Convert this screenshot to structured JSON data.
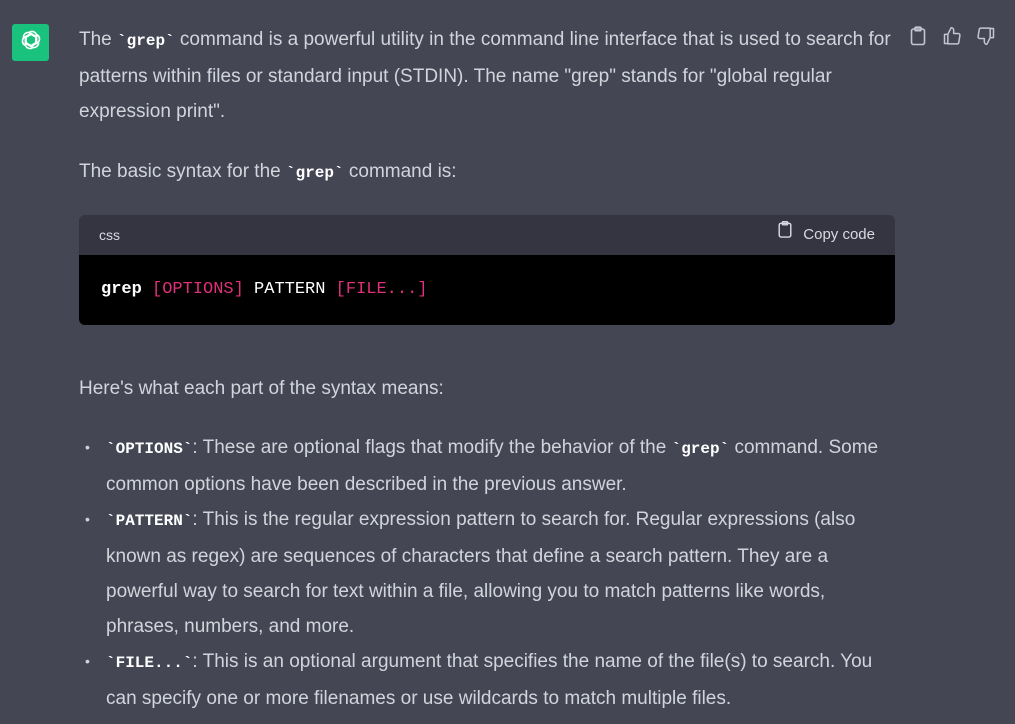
{
  "assistant": {
    "avatar_icon": "openai-logo-icon",
    "avatar_color": "#19c37d"
  },
  "actions": [
    {
      "icon": "clipboard-icon"
    },
    {
      "icon": "thumbs-up-icon"
    },
    {
      "icon": "thumbs-down-icon"
    }
  ],
  "message": {
    "p1": {
      "t1": "The ",
      "code1": "`grep`",
      "t2": " command is a powerful utility in the command line interface that is used to search for patterns within files or standard input (STDIN). The name \"grep\" stands for \"global regular expression print\"."
    },
    "p2": {
      "t1": "The basic syntax for the ",
      "code1": "`grep`",
      "t2": " command is:"
    },
    "codeblock": {
      "language": "css",
      "copy_label": "Copy code",
      "tokens": {
        "cmd": "grep",
        "sp1": " ",
        "options": "[OPTIONS]",
        "sp2": " ",
        "pattern": "PATTERN",
        "sp3": " ",
        "file": "[FILE...]"
      }
    },
    "p3": "Here's what each part of the syntax means:",
    "bullets": [
      {
        "code": "`OPTIONS`",
        "t1": ": These are optional flags that modify the behavior of the ",
        "code2": "`grep`",
        "t2": " command. Some common options have been described in the previous answer."
      },
      {
        "code": "`PATTERN`",
        "t1": ": This is the regular expression pattern to search for. Regular expressions (also known as regex) are sequences of characters that define a search pattern. They are a powerful way to search for text within a file, allowing you to match patterns like words, phrases, numbers, and more."
      },
      {
        "code": "`FILE...`",
        "t1": ": This is an optional argument that specifies the name of the file(s) to search. You can specify one or more filenames or use wildcards to match multiple files."
      }
    ]
  },
  "colors": {
    "background": "#444654",
    "text": "#d1d5db",
    "code_header": "#343541",
    "code_body": "#000000",
    "selector_token": "#df3079"
  }
}
